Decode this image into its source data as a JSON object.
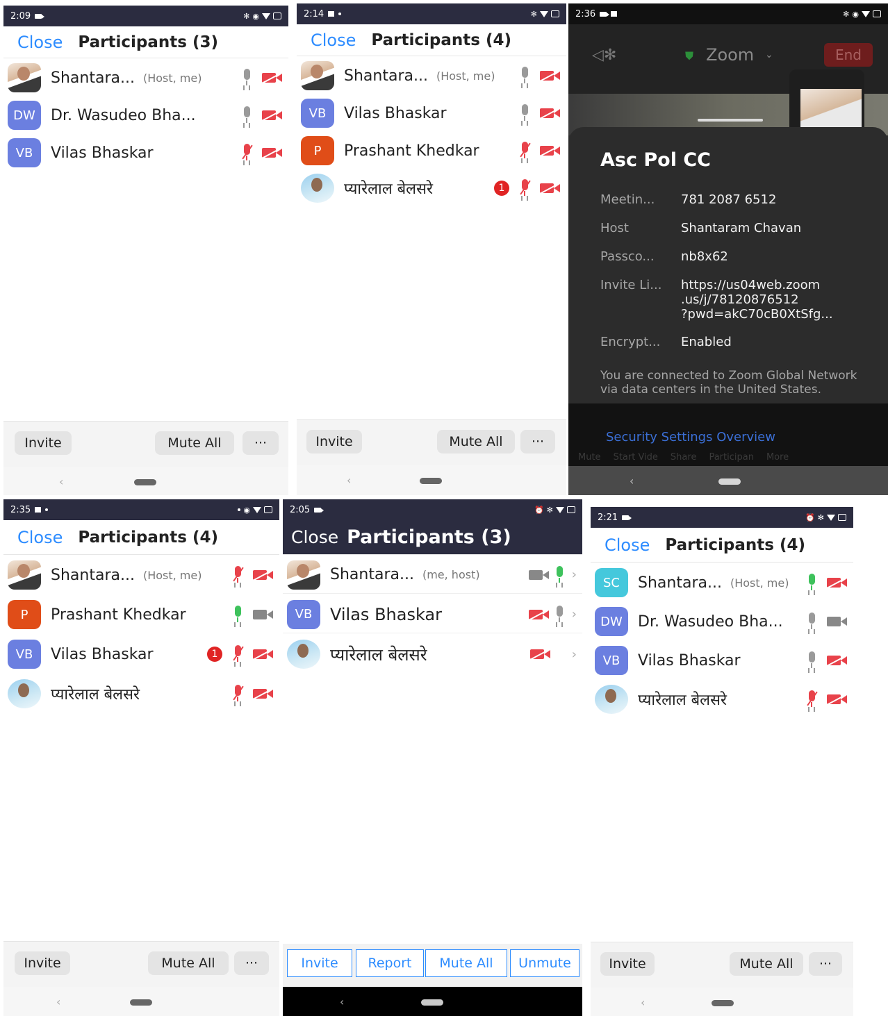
{
  "panels": {
    "p1": {
      "time": "2:09",
      "close": "Close",
      "title": "Participants (3)",
      "rows": [
        {
          "initials": "",
          "name": "Shantara...",
          "tag": "(Host, me)"
        },
        {
          "initials": "DW",
          "name": "Dr. Wasudeo Bha...",
          "tag": ""
        },
        {
          "initials": "VB",
          "name": "Vilas Bhaskar",
          "tag": ""
        }
      ],
      "invite": "Invite",
      "mute_all": "Mute All",
      "more": "···"
    },
    "p2": {
      "time": "2:14",
      "close": "Close",
      "title": "Participants (4)",
      "rows": [
        {
          "initials": "",
          "name": "Shantara...",
          "tag": "(Host, me)"
        },
        {
          "initials": "VB",
          "name": "Vilas Bhaskar",
          "tag": ""
        },
        {
          "initials": "P",
          "name": "Prashant Khedkar",
          "tag": ""
        },
        {
          "initials": "",
          "name": "प्यारेलाल बेलसरे",
          "tag": "",
          "badge": "1"
        }
      ],
      "invite": "Invite",
      "mute_all": "Mute All",
      "more": "···"
    },
    "p3": {
      "time": "2:36",
      "app": "Zoom",
      "end": "End",
      "meeting_title": "Asc Pol CC",
      "info": [
        {
          "label": "Meetin...",
          "value": "781 2087 6512"
        },
        {
          "label": "Host",
          "value": "Shantaram Chavan"
        },
        {
          "label": "Passco...",
          "value": "nb8x62"
        },
        {
          "label": "Invite Li...",
          "value": "https://us04web.zoom\n.us/j/78120876512\n?pwd=akC70cB0XtSfg..."
        },
        {
          "label": "Encrypt...",
          "value": "Enabled"
        }
      ],
      "network_note": "You are connected to Zoom Global Network via data centers in the United States.",
      "security_link": "Security Settings Overview",
      "toolbar": [
        "Mute",
        "Start Vide",
        "Share",
        "Participan",
        "More"
      ]
    },
    "p4": {
      "time": "2:35",
      "close": "Close",
      "title": "Participants (4)",
      "rows": [
        {
          "initials": "",
          "name": "Shantara...",
          "tag": "(Host, me)"
        },
        {
          "initials": "P",
          "name": "Prashant Khedkar",
          "tag": ""
        },
        {
          "initials": "VB",
          "name": "Vilas Bhaskar",
          "tag": "",
          "badge": "1"
        },
        {
          "initials": "",
          "name": "प्यारेलाल बेलसरे",
          "tag": ""
        }
      ],
      "invite": "Invite",
      "mute_all": "Mute All",
      "more": "···"
    },
    "p5": {
      "time": "2:05",
      "close": "Close",
      "title": "Participants (3)",
      "rows": [
        {
          "initials": "",
          "name": "Shantara...",
          "tag": "(me, host)"
        },
        {
          "initials": "VB",
          "name": "Vilas Bhaskar",
          "tag": ""
        },
        {
          "initials": "",
          "name": "प्यारेलाल बेलसरे",
          "tag": ""
        }
      ],
      "buttons": [
        "Invite",
        "Report",
        "Mute All",
        "Unmute"
      ]
    },
    "p6": {
      "time": "2:21",
      "close": "Close",
      "title": "Participants (4)",
      "rows": [
        {
          "initials": "SC",
          "name": "Shantara...",
          "tag": "(Host, me)"
        },
        {
          "initials": "DW",
          "name": "Dr. Wasudeo Bha...",
          "tag": ""
        },
        {
          "initials": "VB",
          "name": "Vilas Bhaskar",
          "tag": ""
        },
        {
          "initials": "",
          "name": "प्यारेलाल बेलसरे",
          "tag": ""
        }
      ],
      "invite": "Invite",
      "mute_all": "Mute All",
      "more": "···"
    }
  },
  "nav_back_glyph": "‹",
  "chevron_glyph": "›",
  "colors": {
    "accent": "#2d8cff",
    "status_bar": "#2b2c40",
    "muted_red": "#e8424a",
    "active_green": "#3ec25c",
    "end_red": "#e02424"
  }
}
